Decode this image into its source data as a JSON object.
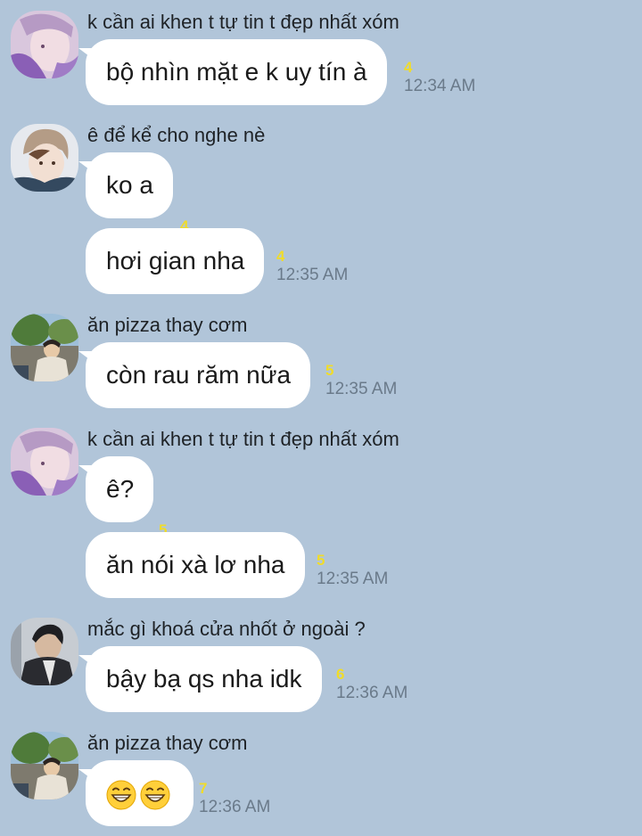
{
  "messages": [
    {
      "sender": "k cần ai khen t tự tin t đẹp nhất xóm",
      "avatar": "avatar-purple-portrait",
      "bubbles": [
        {
          "text": "bộ nhìn mặt e k uy tín à",
          "count": "4",
          "time": "12:34 AM"
        }
      ]
    },
    {
      "sender": "ê để kể cho nghe nè",
      "avatar": "avatar-beanie-portrait",
      "bubbles": [
        {
          "text": "ko a",
          "count": "4",
          "time": ""
        },
        {
          "text": "hơi gian nha",
          "count": "4",
          "time": "12:35 AM"
        }
      ]
    },
    {
      "sender": "ăn pizza thay cơm",
      "avatar": "avatar-outdoor-portrait",
      "bubbles": [
        {
          "text": "còn rau răm nữa",
          "count": "5",
          "time": "12:35 AM"
        }
      ]
    },
    {
      "sender": "k cần ai khen t tự tin t đẹp nhất xóm",
      "avatar": "avatar-purple-portrait",
      "bubbles": [
        {
          "text": "ê?",
          "count": "5",
          "time": ""
        },
        {
          "text": "ăn nói xà lơ nha",
          "count": "5",
          "time": "12:35 AM"
        }
      ]
    },
    {
      "sender": "mắc gì khoá cửa nhốt ở ngoài ?",
      "avatar": "avatar-dark-portrait",
      "bubbles": [
        {
          "text": "bậy bạ qs nha idk",
          "count": "6",
          "time": "12:36 AM"
        }
      ]
    },
    {
      "sender": "ăn pizza thay cơm",
      "avatar": "avatar-outdoor-portrait",
      "bubbles": [
        {
          "text": "",
          "emoji": [
            "grinning-emoji",
            "grinning-emoji"
          ],
          "count": "7",
          "time": "12:36 AM"
        }
      ]
    }
  ],
  "colors": {
    "background": "#b1c5d9",
    "bubble": "#ffffff",
    "read_count": "#f0dc2a",
    "timestamp": "#6a7a8a"
  }
}
